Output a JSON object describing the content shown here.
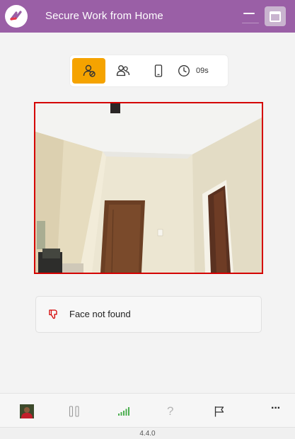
{
  "window": {
    "title": "Secure Work from Home",
    "brand_color": "#9a5fa6"
  },
  "toolbar": {
    "items": [
      {
        "icon": "face-verify-icon",
        "active": true
      },
      {
        "icon": "multiple-people-icon",
        "active": false
      },
      {
        "icon": "mobile-phone-icon",
        "active": false
      },
      {
        "icon": "clock-icon",
        "active": false
      }
    ],
    "timer_value": "09s",
    "active_color": "#f5a300"
  },
  "camera": {
    "border_color": "#d40000"
  },
  "status": {
    "icon": "thumbs-down-icon",
    "message": "Face not found",
    "icon_color": "#d40000"
  },
  "bottombar": {
    "items": [
      {
        "icon": "user-avatar"
      },
      {
        "icon": "pause-icon"
      },
      {
        "icon": "signal-strength-icon"
      },
      {
        "icon": "help-icon",
        "label": "?"
      },
      {
        "icon": "flag-icon"
      },
      {
        "icon": "more-icon",
        "label": "···"
      }
    ],
    "signal_color": "#4caf50"
  },
  "footer": {
    "version": "4.4.0"
  }
}
